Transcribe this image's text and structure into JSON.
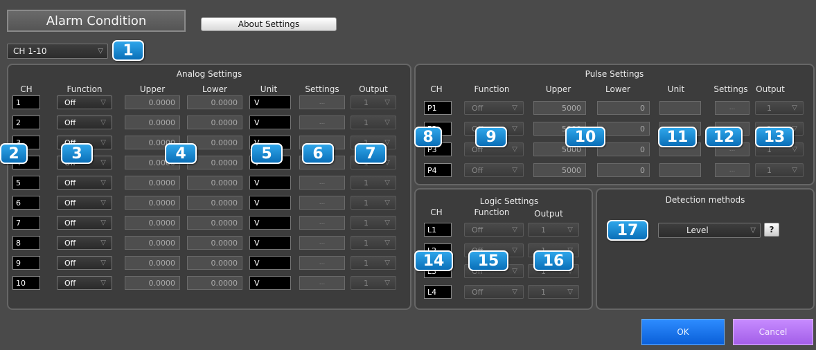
{
  "window": {
    "title": "Alarm Condition",
    "about_button": "About Settings",
    "channel_range": "CH 1-10"
  },
  "icons": {
    "dropdown": "triangle-down-icon",
    "help": "question-icon"
  },
  "analog": {
    "title": "Analog Settings",
    "headers": {
      "ch": "CH",
      "function": "Function",
      "upper": "Upper",
      "lower": "Lower",
      "unit": "Unit",
      "settings": "Settings",
      "output": "Output"
    },
    "rows": [
      {
        "ch": "1",
        "function": "Off",
        "upper": "0.0000",
        "lower": "0.0000",
        "unit": "V",
        "settings": "...",
        "output": "1"
      },
      {
        "ch": "2",
        "function": "Off",
        "upper": "0.0000",
        "lower": "0.0000",
        "unit": "V",
        "settings": "...",
        "output": "1"
      },
      {
        "ch": "3",
        "function": "Off",
        "upper": "0.0000",
        "lower": "0.0000",
        "unit": "V",
        "settings": "...",
        "output": "1"
      },
      {
        "ch": "4",
        "function": "Off",
        "upper": "0.0000",
        "lower": "0.0000",
        "unit": "V",
        "settings": "...",
        "output": "1"
      },
      {
        "ch": "5",
        "function": "Off",
        "upper": "0.0000",
        "lower": "0.0000",
        "unit": "V",
        "settings": "...",
        "output": "1"
      },
      {
        "ch": "6",
        "function": "Off",
        "upper": "0.0000",
        "lower": "0.0000",
        "unit": "V",
        "settings": "...",
        "output": "1"
      },
      {
        "ch": "7",
        "function": "Off",
        "upper": "0.0000",
        "lower": "0.0000",
        "unit": "V",
        "settings": "...",
        "output": "1"
      },
      {
        "ch": "8",
        "function": "Off",
        "upper": "0.0000",
        "lower": "0.0000",
        "unit": "V",
        "settings": "...",
        "output": "1"
      },
      {
        "ch": "9",
        "function": "Off",
        "upper": "0.0000",
        "lower": "0.0000",
        "unit": "V",
        "settings": "...",
        "output": "1"
      },
      {
        "ch": "10",
        "function": "Off",
        "upper": "0.0000",
        "lower": "0.0000",
        "unit": "V",
        "settings": "...",
        "output": "1"
      }
    ]
  },
  "pulse": {
    "title": "Pulse Settings",
    "headers": {
      "ch": "CH",
      "function": "Function",
      "upper": "Upper",
      "lower": "Lower",
      "unit": "Unit",
      "settings": "Settings",
      "output": "Output"
    },
    "rows": [
      {
        "ch": "P1",
        "function": "Off",
        "upper": "5000",
        "lower": "0",
        "unit": "",
        "settings": "...",
        "output": "1"
      },
      {
        "ch": "P2",
        "function": "Off",
        "upper": "5000",
        "lower": "0",
        "unit": "",
        "settings": "...",
        "output": "1"
      },
      {
        "ch": "P3",
        "function": "Off",
        "upper": "5000",
        "lower": "0",
        "unit": "",
        "settings": "...",
        "output": "1"
      },
      {
        "ch": "P4",
        "function": "Off",
        "upper": "5000",
        "lower": "0",
        "unit": "",
        "settings": "...",
        "output": "1"
      }
    ]
  },
  "logic": {
    "title": "Logic Settings",
    "headers": {
      "ch": "CH",
      "function": "Function",
      "output": "Output"
    },
    "rows": [
      {
        "ch": "L1",
        "function": "Off",
        "output": "1"
      },
      {
        "ch": "L2",
        "function": "Off",
        "output": "1"
      },
      {
        "ch": "L3",
        "function": "Off",
        "output": "1"
      },
      {
        "ch": "L4",
        "function": "Off",
        "output": "1"
      }
    ]
  },
  "detection": {
    "title": "Detection methods",
    "method": "Level",
    "help_label": "?"
  },
  "buttons": {
    "ok": "OK",
    "cancel": "Cancel"
  },
  "callouts": [
    "1",
    "2",
    "3",
    "4",
    "5",
    "6",
    "7",
    "8",
    "9",
    "10",
    "11",
    "12",
    "13",
    "14",
    "15",
    "16",
    "17"
  ]
}
